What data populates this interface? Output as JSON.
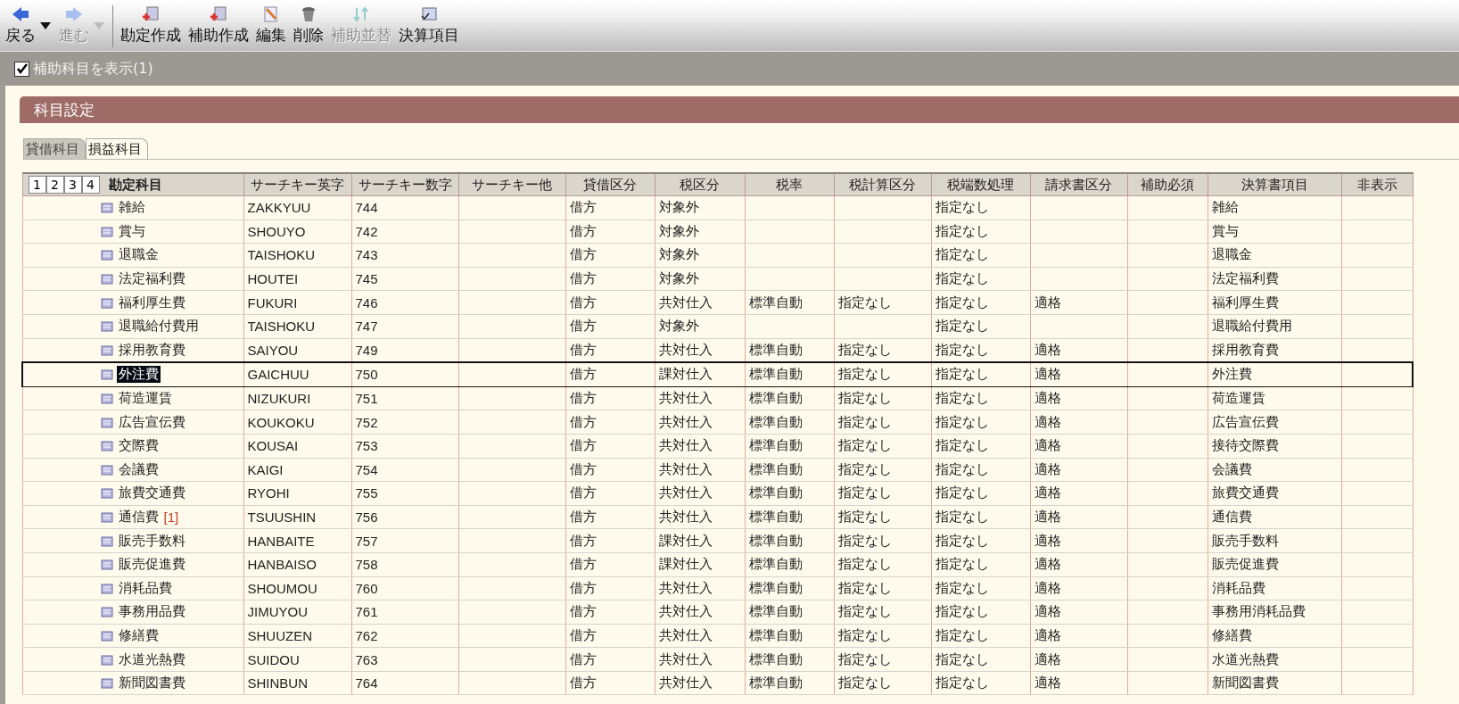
{
  "toolbar": {
    "items": [
      {
        "label": "戻る",
        "kind": "back",
        "disabled": false,
        "dropdown": true
      },
      {
        "label": "進む",
        "kind": "forward",
        "disabled": true,
        "dropdown": true
      },
      {
        "label": "勘定作成",
        "kind": "addaccount",
        "disabled": false,
        "separator_before": true
      },
      {
        "label": "補助作成",
        "kind": "addsub",
        "disabled": false
      },
      {
        "label": "編集",
        "kind": "edit",
        "disabled": false
      },
      {
        "label": "削除",
        "kind": "delete",
        "disabled": false
      },
      {
        "label": "補助並替",
        "kind": "sort",
        "disabled": true
      },
      {
        "label": "決算項目",
        "kind": "report",
        "disabled": false
      }
    ]
  },
  "options": {
    "show_sub_accounts": {
      "label": "補助科目を表示(1)",
      "checked": true
    }
  },
  "panel": {
    "title": "科目設定",
    "tabs": [
      {
        "label": "貸借科目",
        "selected": false
      },
      {
        "label": "損益科目",
        "selected": true
      }
    ],
    "levels": [
      {
        "label": "1",
        "selected": false
      },
      {
        "label": "2",
        "selected": false
      },
      {
        "label": "3",
        "selected": false
      },
      {
        "label": "4",
        "selected": false
      }
    ],
    "columns": [
      "勘定科目",
      "サーチキー英字",
      "サーチキー数字",
      "サーチキー他",
      "貸借区分",
      "税区分",
      "税率",
      "税計算区分",
      "税端数処理",
      "請求書区分",
      "補助必須",
      "決算書項目",
      "非表示"
    ],
    "rows": [
      {
        "selected": false,
        "cells": [
          "雑給",
          "ZAKKYUU",
          "744",
          "",
          "借方",
          "対象外",
          "",
          "",
          "指定なし",
          "",
          "",
          "雑給",
          ""
        ]
      },
      {
        "selected": false,
        "cells": [
          "賞与",
          "SHOUYO",
          "742",
          "",
          "借方",
          "対象外",
          "",
          "",
          "指定なし",
          "",
          "",
          "賞与",
          ""
        ]
      },
      {
        "selected": false,
        "cells": [
          "退職金",
          "TAISHOKU",
          "743",
          "",
          "借方",
          "対象外",
          "",
          "",
          "指定なし",
          "",
          "",
          "退職金",
          ""
        ]
      },
      {
        "selected": false,
        "cells": [
          "法定福利費",
          "HOUTEI",
          "745",
          "",
          "借方",
          "対象外",
          "",
          "",
          "指定なし",
          "",
          "",
          "法定福利費",
          ""
        ]
      },
      {
        "selected": false,
        "cells": [
          "福利厚生費",
          "FUKURI",
          "746",
          "",
          "借方",
          "共対仕入",
          "標準自動",
          "指定なし",
          "指定なし",
          "適格",
          "",
          "福利厚生費",
          ""
        ]
      },
      {
        "selected": false,
        "cells": [
          "退職給付費用",
          "TAISHOKU",
          "747",
          "",
          "借方",
          "対象外",
          "",
          "",
          "指定なし",
          "",
          "",
          "退職給付費用",
          ""
        ]
      },
      {
        "selected": false,
        "cells": [
          "採用教育費",
          "SAIYOU",
          "749",
          "",
          "借方",
          "共対仕入",
          "標準自動",
          "指定なし",
          "指定なし",
          "適格",
          "",
          "採用教育費",
          ""
        ]
      },
      {
        "selected": true,
        "cells": [
          "外注費",
          "GAICHUU",
          "750",
          "",
          "借方",
          "課対仕入",
          "標準自動",
          "指定なし",
          "指定なし",
          "適格",
          "",
          "外注費",
          ""
        ]
      },
      {
        "selected": false,
        "cells": [
          "荷造運賃",
          "NIZUKURI",
          "751",
          "",
          "借方",
          "共対仕入",
          "標準自動",
          "指定なし",
          "指定なし",
          "適格",
          "",
          "荷造運賃",
          ""
        ]
      },
      {
        "selected": false,
        "cells": [
          "広告宣伝費",
          "KOUKOKU",
          "752",
          "",
          "借方",
          "共対仕入",
          "標準自動",
          "指定なし",
          "指定なし",
          "適格",
          "",
          "広告宣伝費",
          ""
        ]
      },
      {
        "selected": false,
        "cells": [
          "交際費",
          "KOUSAI",
          "753",
          "",
          "借方",
          "共対仕入",
          "標準自動",
          "指定なし",
          "指定なし",
          "適格",
          "",
          "接待交際費",
          ""
        ]
      },
      {
        "selected": false,
        "cells": [
          "会議費",
          "KAIGI",
          "754",
          "",
          "借方",
          "共対仕入",
          "標準自動",
          "指定なし",
          "指定なし",
          "適格",
          "",
          "会議費",
          ""
        ]
      },
      {
        "selected": false,
        "cells": [
          "旅費交通費",
          "RYOHI",
          "755",
          "",
          "借方",
          "共対仕入",
          "標準自動",
          "指定なし",
          "指定なし",
          "適格",
          "",
          "旅費交通費",
          ""
        ]
      },
      {
        "selected": false,
        "sub_count": "[1]",
        "cells": [
          "通信費",
          "TSUUSHIN",
          "756",
          "",
          "借方",
          "共対仕入",
          "標準自動",
          "指定なし",
          "指定なし",
          "適格",
          "",
          "通信費",
          ""
        ]
      },
      {
        "selected": false,
        "cells": [
          "販売手数料",
          "HANBAITE",
          "757",
          "",
          "借方",
          "課対仕入",
          "標準自動",
          "指定なし",
          "指定なし",
          "適格",
          "",
          "販売手数料",
          ""
        ]
      },
      {
        "selected": false,
        "cells": [
          "販売促進費",
          "HANBAISO",
          "758",
          "",
          "借方",
          "課対仕入",
          "標準自動",
          "指定なし",
          "指定なし",
          "適格",
          "",
          "販売促進費",
          ""
        ]
      },
      {
        "selected": false,
        "cells": [
          "消耗品費",
          "SHOUMOU",
          "760",
          "",
          "借方",
          "共対仕入",
          "標準自動",
          "指定なし",
          "指定なし",
          "適格",
          "",
          "消耗品費",
          ""
        ]
      },
      {
        "selected": false,
        "cells": [
          "事務用品費",
          "JIMUYOU",
          "761",
          "",
          "借方",
          "共対仕入",
          "標準自動",
          "指定なし",
          "指定なし",
          "適格",
          "",
          "事務用消耗品費",
          ""
        ]
      },
      {
        "selected": false,
        "cells": [
          "修繕費",
          "SHUUZEN",
          "762",
          "",
          "借方",
          "共対仕入",
          "標準自動",
          "指定なし",
          "指定なし",
          "適格",
          "",
          "修繕費",
          ""
        ]
      },
      {
        "selected": false,
        "cells": [
          "水道光熱費",
          "SUIDOU",
          "763",
          "",
          "借方",
          "共対仕入",
          "標準自動",
          "指定なし",
          "指定なし",
          "適格",
          "",
          "水道光熱費",
          ""
        ]
      },
      {
        "selected": false,
        "cells": [
          "新聞図書費",
          "SHINBUN",
          "764",
          "",
          "借方",
          "共対仕入",
          "標準自動",
          "指定なし",
          "指定なし",
          "適格",
          "",
          "新聞図書費",
          ""
        ]
      }
    ]
  }
}
